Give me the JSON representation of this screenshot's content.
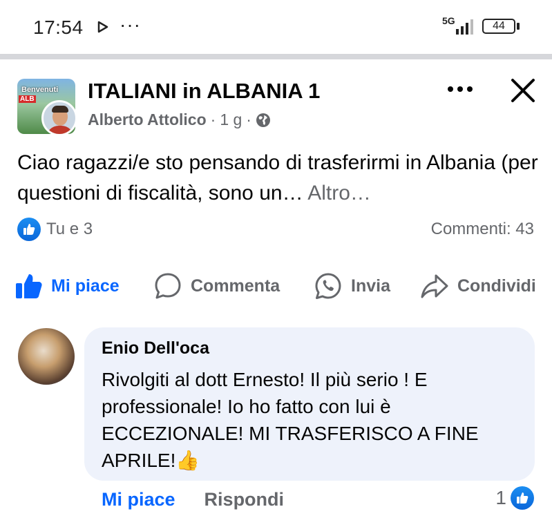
{
  "status_bar": {
    "time": "17:54",
    "dots": "···",
    "network": "5G",
    "battery": "44",
    "icons": [
      "play-icon",
      "signal-icon",
      "battery-icon"
    ]
  },
  "post": {
    "group_name": "ITALIANI in ALBANIA 1",
    "group_avatar_text_1": "Benvenuti",
    "group_avatar_text_2": "ALB",
    "author": "Alberto Attolico",
    "meta_sep_1": "·",
    "time_ago": "1 g",
    "meta_sep_2": "·",
    "text": "Ciao ragazzi/e sto pensando di trasferirmi in Albania (per questioni di fiscalità, sono un… ",
    "more_label": "Altro…",
    "reactions_label": "Tu e 3",
    "comments_label": "Commenti: 43"
  },
  "actions": {
    "like": "Mi piace",
    "comment": "Commenta",
    "send": "Invia",
    "share": "Condividi"
  },
  "comment": {
    "author": "Enio Dell'oca",
    "text": "Rivolgiti al dott Ernesto! Il più serio ! E professionale! Io ho fatto con lui è ECCEZIONALE! MI TRASFERISCO A FINE APRILE!",
    "emoji": "👍",
    "like_label": "Mi piace",
    "reply_label": "Rispondi",
    "reaction_count": "1"
  },
  "colors": {
    "accent": "#0866ff",
    "secondary_text": "#65676b",
    "bubble": "#eef2fb",
    "divider": "#d6d7db"
  }
}
